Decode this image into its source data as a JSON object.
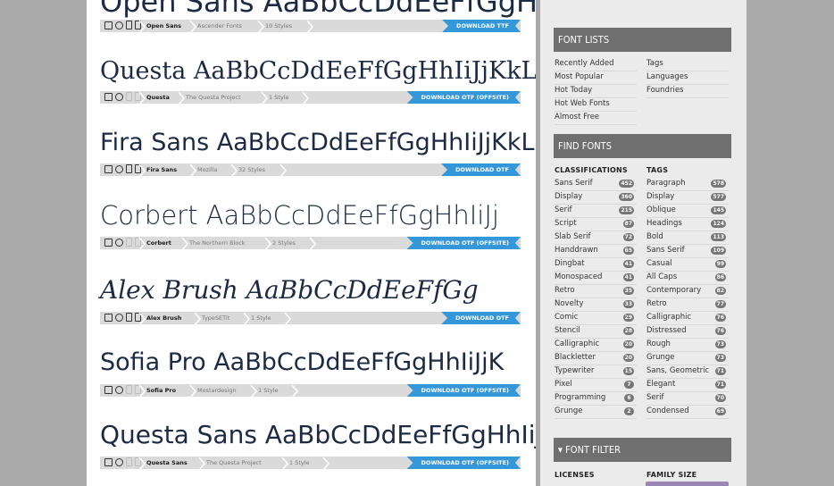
{
  "fonts": [
    {
      "sample": "Open Sans AaBbCcDdEeFfGgHhIiJj",
      "name": "Open Sans",
      "foundry": "Ascender Fonts",
      "styles": "10 Styles",
      "download": "DOWNLOAD TTF"
    },
    {
      "sample": "Questa AaBbCcDdEeFfGgHhIiJjKkLl",
      "name": "Questa",
      "foundry": "The Questa Project",
      "styles": "1 Style",
      "download": "DOWNLOAD OTF (OFFSITE)"
    },
    {
      "sample": "Fira Sans AaBbCcDdEeFfGgHhIiJjKkL",
      "name": "Fira Sans",
      "foundry": "Mozilla",
      "styles": "32 Styles",
      "download": "DOWNLOAD OTF"
    },
    {
      "sample": "Corbert AaBbCcDdEeFfGgHhIiJj",
      "name": "Corbert",
      "foundry": "The Northern Block",
      "styles": "2 Styles",
      "download": "DOWNLOAD OTF (OFFSITE)"
    },
    {
      "sample": "Alex Brush AaBbCcDdEeFfGg",
      "name": "Alex Brush",
      "foundry": "TypeSETit",
      "styles": "1 Style",
      "download": "DOWNLOAD OTF"
    },
    {
      "sample": "Sofia Pro AaBbCcDdEeFfGgHhIiJjK",
      "name": "Sofia Pro",
      "foundry": "Mostardesign",
      "styles": "1 Style",
      "download": "DOWNLOAD OTF (OFFSITE)"
    },
    {
      "sample": "Questa Sans AaBbCcDdEeFfGgHhIiJj",
      "name": "Questa Sans",
      "foundry": "The Questa Project",
      "styles": "1 Style",
      "download": "DOWNLOAD OTF (OFFSITE)"
    }
  ],
  "sidebar": {
    "font_lists": {
      "title": "FONT LISTS",
      "left": [
        "Recently Added",
        "Most Popular",
        "Hot Today",
        "Hot Web Fonts",
        "Almost Free"
      ],
      "right": [
        "Tags",
        "Languages",
        "Foundries"
      ]
    },
    "find_fonts": {
      "title": "FIND FONTS",
      "classifications_label": "CLASSIFICATIONS",
      "tags_label": "TAGS",
      "classifications": [
        {
          "label": "Sans Serif",
          "count": "452"
        },
        {
          "label": "Display",
          "count": "360"
        },
        {
          "label": "Serif",
          "count": "215"
        },
        {
          "label": "Script",
          "count": "87"
        },
        {
          "label": "Slab Serif",
          "count": "72"
        },
        {
          "label": "Handdrawn",
          "count": "65"
        },
        {
          "label": "Dingbat",
          "count": "41"
        },
        {
          "label": "Monospaced",
          "count": "41"
        },
        {
          "label": "Retro",
          "count": "35"
        },
        {
          "label": "Novelty",
          "count": "33"
        },
        {
          "label": "Comic",
          "count": "29"
        },
        {
          "label": "Stencil",
          "count": "28"
        },
        {
          "label": "Calligraphic",
          "count": "20"
        },
        {
          "label": "Blackletter",
          "count": "20"
        },
        {
          "label": "Typewriter",
          "count": "15"
        },
        {
          "label": "Pixel",
          "count": "7"
        },
        {
          "label": "Programming",
          "count": "6"
        },
        {
          "label": "Grunge",
          "count": "2"
        }
      ],
      "tags": [
        {
          "label": "Paragraph",
          "count": "578"
        },
        {
          "label": "Display",
          "count": "577"
        },
        {
          "label": "Oblique",
          "count": "145"
        },
        {
          "label": "Headings",
          "count": "124"
        },
        {
          "label": "Bold",
          "count": "113"
        },
        {
          "label": "Sans Serif",
          "count": "109"
        },
        {
          "label": "Casual",
          "count": "99"
        },
        {
          "label": "All Caps",
          "count": "86"
        },
        {
          "label": "Contemporary",
          "count": "82"
        },
        {
          "label": "Retro",
          "count": "77"
        },
        {
          "label": "Calligraphic",
          "count": "76"
        },
        {
          "label": "Distressed",
          "count": "76"
        },
        {
          "label": "Rough",
          "count": "73"
        },
        {
          "label": "Grunge",
          "count": "73"
        },
        {
          "label": "Sans, Geometric",
          "count": "71"
        },
        {
          "label": "Elegant",
          "count": "71"
        },
        {
          "label": "Serif",
          "count": "70"
        },
        {
          "label": "Condensed",
          "count": "69"
        }
      ]
    },
    "font_filter": {
      "title": "▾  FONT FILTER",
      "licenses_label": "LICENSES",
      "family_size_label": "FAMILY SIZE"
    }
  },
  "colors": {
    "download_blue": "#3397d9",
    "header_gray": "#6f6f6f",
    "badge_gray": "#777777"
  }
}
